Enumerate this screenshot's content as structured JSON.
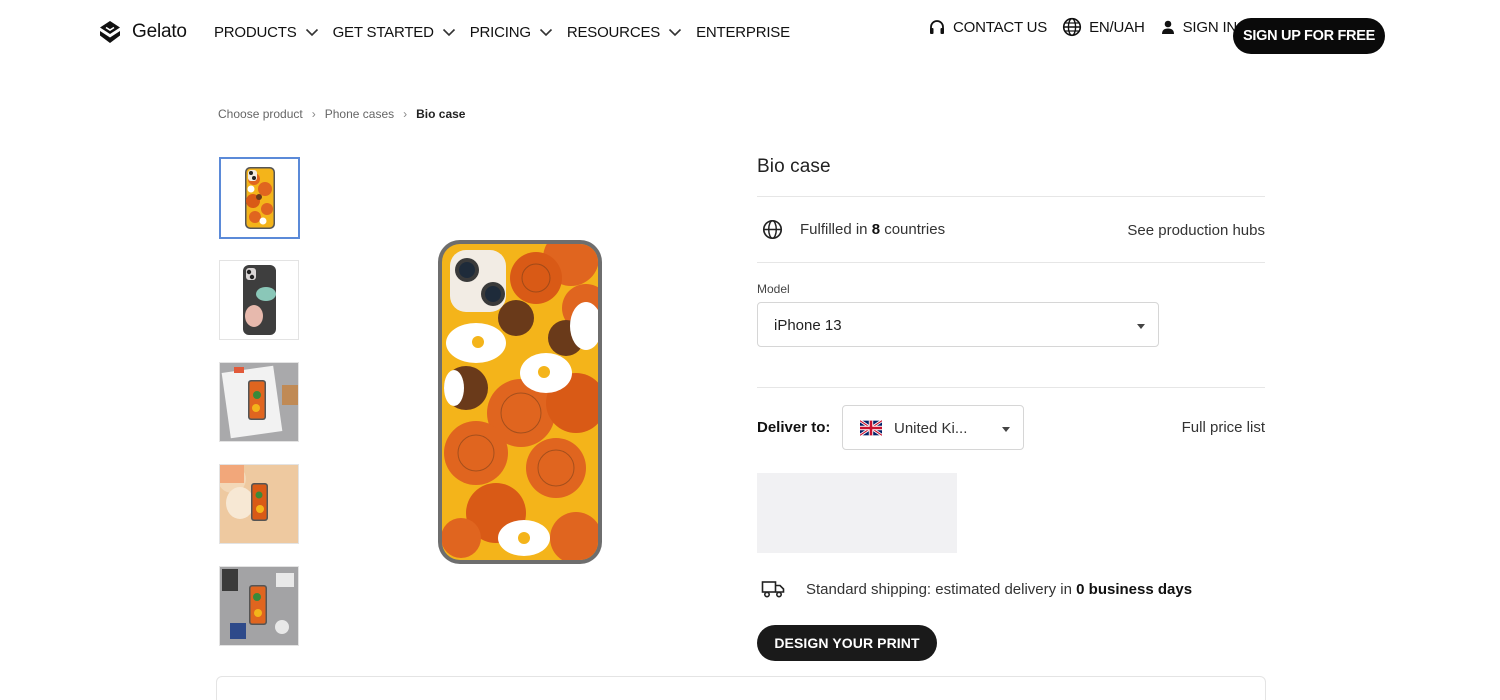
{
  "header": {
    "logo_text": "Gelato",
    "logo_icon": "gelato-logo-icon",
    "nav": [
      {
        "label": "PRODUCTS",
        "has_dropdown": true
      },
      {
        "label": "GET STARTED",
        "has_dropdown": true
      },
      {
        "label": "PRICING",
        "has_dropdown": true
      },
      {
        "label": "RESOURCES",
        "has_dropdown": true
      },
      {
        "label": "ENTERPRISE",
        "has_dropdown": false
      }
    ],
    "contact_label": "CONTACT US",
    "contact_icon": "headset-icon",
    "locale_label": "EN/UAH",
    "locale_icon": "globe-icon",
    "signin_label": "SIGN IN",
    "signin_icon": "user-icon",
    "signup_label": "SIGN UP FOR FREE"
  },
  "breadcrumb": [
    {
      "label": "Choose product"
    },
    {
      "label": "Phone cases"
    },
    {
      "label": "Bio case"
    }
  ],
  "gallery": {
    "thumbnails": [
      {
        "name": "thumb-floral-case",
        "active": true
      },
      {
        "name": "thumb-abstract-case",
        "active": false
      },
      {
        "name": "thumb-lifestyle-desk",
        "active": false
      },
      {
        "name": "thumb-lifestyle-peach",
        "active": false
      },
      {
        "name": "thumb-lifestyle-grey",
        "active": false
      }
    ]
  },
  "product": {
    "title": "Bio case",
    "fulfilled_prefix": "Fulfilled in ",
    "fulfilled_count": "8",
    "fulfilled_suffix": " countries",
    "production_hubs_link": "See production hubs",
    "model_label": "Model",
    "model_value": "iPhone 13",
    "deliver_label": "Deliver to:",
    "country_value": "United Ki...",
    "country_flag": "uk-flag-icon",
    "price_list_link": "Full price list",
    "shipping_prefix": "Standard shipping: estimated delivery in ",
    "shipping_days": "0 business days",
    "shipping_icon": "truck-icon",
    "design_button": "DESIGN YOUR PRINT"
  },
  "colors": {
    "accent_dark": "#0a0a0a",
    "thumbnail_active_border": "#5b8ad8",
    "case_orange": "#e0651f",
    "case_yellow": "#f4b41a"
  }
}
